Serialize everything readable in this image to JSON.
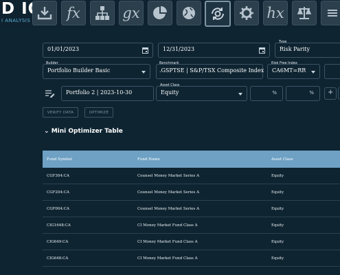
{
  "logo": {
    "big": "D IQ",
    "small": "I ANALYSIS"
  },
  "toolbar": {
    "fx": "fx",
    "gx": "gx",
    "hx": "hx"
  },
  "form": {
    "start_date": "01/01/2023",
    "end_date": "12/31/2023",
    "type_label": "Type",
    "type_value": "Risk Parity",
    "builder_label": "Builder",
    "builder_value": "Portfolio Builder Basic",
    "benchmark_label": "Benchmark",
    "benchmark_value": ".GSPTSE | S&P/TSX Composite Index",
    "riskfree_label": "Risk Free Index",
    "riskfree_value": "CA6MT=RR",
    "portfolio_value": "Portfolio 2 | 2023-10-30",
    "asset_class_label": "Asset Class",
    "asset_class_value": "Equity",
    "pct_symbol_1": "%",
    "pct_symbol_2": "%",
    "add_symbol": "+"
  },
  "buttons": {
    "verify": "VERIFY DATA",
    "optimize": "OPTIMIZE"
  },
  "section": {
    "title": "Mini Optimizer Table"
  },
  "table": {
    "headers": [
      "Fund Symbol",
      "Fund Name",
      "Asset Class"
    ],
    "rows": [
      [
        "CGF304:CA",
        "Counsel Money Market Series A",
        "Equity"
      ],
      [
        "CGF204:CA",
        "Counsel Money Market Series A",
        "Equity"
      ],
      [
        "CGF004:CA",
        "Counsel Money Market Series A",
        "Equity"
      ],
      [
        "CIG1648:CA",
        "CI Money Market Fund Class A",
        "Equity"
      ],
      [
        "CIG649:CA",
        "CI Money Market Fund Class A",
        "Equity"
      ],
      [
        "CIG648:CA",
        "CI Money Market Fund Class A",
        "Equity"
      ]
    ]
  }
}
